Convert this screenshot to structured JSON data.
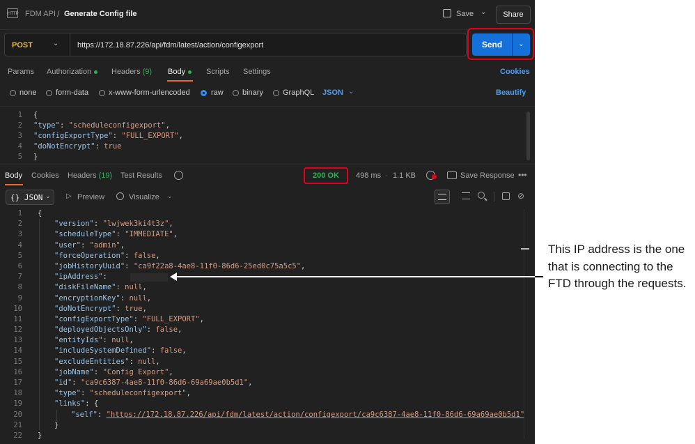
{
  "header": {
    "app_name": "FDM API",
    "separator": "/",
    "request_name": "Generate Config file",
    "save_label": "Save",
    "share_label": "Share",
    "icon_text": "HTTP"
  },
  "request": {
    "method": "POST",
    "url": "https://172.18.87.226/api/fdm/latest/action/configexport",
    "send_label": "Send",
    "tabs": [
      {
        "label": "Params"
      },
      {
        "label": "Authorization"
      },
      {
        "label": "Headers",
        "count": "(9)"
      },
      {
        "label": "Body"
      },
      {
        "label": "Scripts"
      },
      {
        "label": "Settings"
      }
    ],
    "cookies_label": "Cookies",
    "body_types": [
      "none",
      "form-data",
      "x-www-form-urlencoded",
      "raw",
      "binary",
      "GraphQL"
    ],
    "selected_body_type": "raw",
    "body_format": "JSON",
    "beautify_label": "Beautify",
    "body_lines": [
      {
        "n": "1",
        "parts": [
          {
            "t": "{",
            "c": "p"
          }
        ]
      },
      {
        "n": "2",
        "parts": [
          {
            "t": "\"type\"",
            "c": "k"
          },
          {
            "t": ": ",
            "c": "p"
          },
          {
            "t": "\"scheduleconfigexport\"",
            "c": "s"
          },
          {
            "t": ",",
            "c": "p"
          }
        ]
      },
      {
        "n": "3",
        "parts": [
          {
            "t": "\"configExportType\"",
            "c": "k"
          },
          {
            "t": ": ",
            "c": "p"
          },
          {
            "t": "\"FULL_EXPORT\"",
            "c": "s"
          },
          {
            "t": ",",
            "c": "p"
          }
        ]
      },
      {
        "n": "4",
        "parts": [
          {
            "t": "\"doNotEncrypt\"",
            "c": "k"
          },
          {
            "t": ": ",
            "c": "p"
          },
          {
            "t": "true",
            "c": "b"
          }
        ]
      },
      {
        "n": "5",
        "parts": [
          {
            "t": "}",
            "c": "p"
          }
        ]
      }
    ]
  },
  "response": {
    "tabs": [
      {
        "label": "Body"
      },
      {
        "label": "Cookies"
      },
      {
        "label": "Headers",
        "count": "(19)"
      },
      {
        "label": "Test Results"
      }
    ],
    "status": "200 OK",
    "time": "498 ms",
    "size": "1.1 KB",
    "save_response_label": "Save Response",
    "format_label": "{} JSON",
    "preview_label": "Preview",
    "visualize_label": "Visualize",
    "lines": [
      {
        "n": "1",
        "indent": 0,
        "parts": [
          {
            "t": "{",
            "c": "p"
          }
        ]
      },
      {
        "n": "2",
        "indent": 1,
        "parts": [
          {
            "t": "\"version\"",
            "c": "k"
          },
          {
            "t": ": ",
            "c": "p"
          },
          {
            "t": "\"lwjwek3ki4t3z\"",
            "c": "s"
          },
          {
            "t": ",",
            "c": "p"
          }
        ]
      },
      {
        "n": "3",
        "indent": 1,
        "parts": [
          {
            "t": "\"scheduleType\"",
            "c": "k"
          },
          {
            "t": ": ",
            "c": "p"
          },
          {
            "t": "\"IMMEDIATE\"",
            "c": "s"
          },
          {
            "t": ",",
            "c": "p"
          }
        ]
      },
      {
        "n": "4",
        "indent": 1,
        "parts": [
          {
            "t": "\"user\"",
            "c": "k"
          },
          {
            "t": ": ",
            "c": "p"
          },
          {
            "t": "\"admin\"",
            "c": "s"
          },
          {
            "t": ",",
            "c": "p"
          }
        ]
      },
      {
        "n": "5",
        "indent": 1,
        "parts": [
          {
            "t": "\"forceOperation\"",
            "c": "k"
          },
          {
            "t": ": ",
            "c": "p"
          },
          {
            "t": "false",
            "c": "b"
          },
          {
            "t": ",",
            "c": "p"
          }
        ]
      },
      {
        "n": "6",
        "indent": 1,
        "parts": [
          {
            "t": "\"jobHistoryUuid\"",
            "c": "k"
          },
          {
            "t": ": ",
            "c": "p"
          },
          {
            "t": "\"ca9f22a8-4ae8-11f0-86d6-25ed0c75a5c5\"",
            "c": "s"
          },
          {
            "t": ",",
            "c": "p"
          }
        ]
      },
      {
        "n": "7",
        "indent": 1,
        "parts": [
          {
            "t": "\"ipAddress\"",
            "c": "k"
          },
          {
            "t": ": ",
            "c": "p"
          },
          {
            "t": "           ",
            "c": "p"
          },
          {
            "t": ",",
            "c": "p"
          }
        ]
      },
      {
        "n": "8",
        "indent": 1,
        "parts": [
          {
            "t": "\"diskFileName\"",
            "c": "k"
          },
          {
            "t": ": ",
            "c": "p"
          },
          {
            "t": "null",
            "c": "b"
          },
          {
            "t": ",",
            "c": "p"
          }
        ]
      },
      {
        "n": "9",
        "indent": 1,
        "parts": [
          {
            "t": "\"encryptionKey\"",
            "c": "k"
          },
          {
            "t": ": ",
            "c": "p"
          },
          {
            "t": "null",
            "c": "b"
          },
          {
            "t": ",",
            "c": "p"
          }
        ]
      },
      {
        "n": "10",
        "indent": 1,
        "parts": [
          {
            "t": "\"doNotEncrypt\"",
            "c": "k"
          },
          {
            "t": ": ",
            "c": "p"
          },
          {
            "t": "true",
            "c": "b"
          },
          {
            "t": ",",
            "c": "p"
          }
        ]
      },
      {
        "n": "11",
        "indent": 1,
        "parts": [
          {
            "t": "\"configExportType\"",
            "c": "k"
          },
          {
            "t": ": ",
            "c": "p"
          },
          {
            "t": "\"FULL_EXPORT\"",
            "c": "s"
          },
          {
            "t": ",",
            "c": "p"
          }
        ]
      },
      {
        "n": "12",
        "indent": 1,
        "parts": [
          {
            "t": "\"deployedObjectsOnly\"",
            "c": "k"
          },
          {
            "t": ": ",
            "c": "p"
          },
          {
            "t": "false",
            "c": "b"
          },
          {
            "t": ",",
            "c": "p"
          }
        ]
      },
      {
        "n": "13",
        "indent": 1,
        "parts": [
          {
            "t": "\"entityIds\"",
            "c": "k"
          },
          {
            "t": ": ",
            "c": "p"
          },
          {
            "t": "null",
            "c": "b"
          },
          {
            "t": ",",
            "c": "p"
          }
        ]
      },
      {
        "n": "14",
        "indent": 1,
        "parts": [
          {
            "t": "\"includeSystemDefined\"",
            "c": "k"
          },
          {
            "t": ": ",
            "c": "p"
          },
          {
            "t": "false",
            "c": "b"
          },
          {
            "t": ",",
            "c": "p"
          }
        ]
      },
      {
        "n": "15",
        "indent": 1,
        "parts": [
          {
            "t": "\"excludeEntities\"",
            "c": "k"
          },
          {
            "t": ": ",
            "c": "p"
          },
          {
            "t": "null",
            "c": "b"
          },
          {
            "t": ",",
            "c": "p"
          }
        ]
      },
      {
        "n": "16",
        "indent": 1,
        "parts": [
          {
            "t": "\"jobName\"",
            "c": "k"
          },
          {
            "t": ": ",
            "c": "p"
          },
          {
            "t": "\"Config Export\"",
            "c": "s"
          },
          {
            "t": ",",
            "c": "p"
          }
        ]
      },
      {
        "n": "17",
        "indent": 1,
        "parts": [
          {
            "t": "\"id\"",
            "c": "k"
          },
          {
            "t": ": ",
            "c": "p"
          },
          {
            "t": "\"ca9c6387-4ae8-11f0-86d6-69a69ae0b5d1\"",
            "c": "s"
          },
          {
            "t": ",",
            "c": "p"
          }
        ]
      },
      {
        "n": "18",
        "indent": 1,
        "parts": [
          {
            "t": "\"type\"",
            "c": "k"
          },
          {
            "t": ": ",
            "c": "p"
          },
          {
            "t": "\"scheduleconfigexport\"",
            "c": "s"
          },
          {
            "t": ",",
            "c": "p"
          }
        ]
      },
      {
        "n": "19",
        "indent": 1,
        "parts": [
          {
            "t": "\"links\"",
            "c": "k"
          },
          {
            "t": ": {",
            "c": "p"
          }
        ]
      },
      {
        "n": "20",
        "indent": 2,
        "parts": [
          {
            "t": "\"self\"",
            "c": "k"
          },
          {
            "t": ": ",
            "c": "p"
          },
          {
            "t": "\"https://172.18.87.226/api/fdm/latest/action/configexport/ca9c6387-4ae8-11f0-86d6-69a69ae0b5d1\"",
            "c": "s",
            "u": true
          }
        ]
      },
      {
        "n": "21",
        "indent": 1,
        "parts": [
          {
            "t": "}",
            "c": "p"
          }
        ]
      },
      {
        "n": "22",
        "indent": 0,
        "parts": [
          {
            "t": "}",
            "c": "p"
          }
        ]
      }
    ]
  },
  "annotation": {
    "text": "This IP address is the one that is connecting to the FTD through the requests."
  },
  "icons": {
    "save": "save-icon",
    "chevron": "chevron-down-icon",
    "history": "history-icon",
    "globe": "globe-icon",
    "more": "more-icon",
    "preview": "play-icon",
    "visualize": "visualize-icon",
    "wrap": "wrap-lines-icon",
    "filter": "filter-icon",
    "search": "search-icon",
    "copy": "copy-icon",
    "link": "link-icon"
  },
  "colors": {
    "accent_blue": "#1670d9",
    "highlight_red": "#e0001b",
    "status_green": "#31b05b",
    "active_tab": "#e8693a"
  }
}
